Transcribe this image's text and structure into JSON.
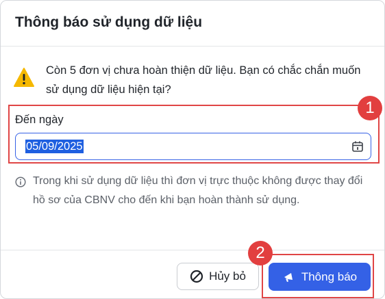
{
  "dialog": {
    "title": "Thông báo sử dụng dữ liệu",
    "message": "Còn 5 đơn vị chưa hoàn thiện dữ liệu. Bạn có chắc chắn muốn sử dụng dữ liệu hiện tại?",
    "field_label": "Đến ngày",
    "date_value": "05/09/2025",
    "note": "Trong khi sử dụng dữ liệu thì đơn vị trực thuộc không được thay đổi hồ sơ của CBNV cho đến khi bạn hoàn thành sử dụng.",
    "cancel_label": "Hủy bỏ",
    "notify_label": "Thông báo"
  },
  "annotations": {
    "badge_1": "1",
    "badge_2": "2"
  },
  "icons": {
    "warning": "warning-triangle-icon",
    "calendar": "calendar-icon",
    "info": "info-circle-icon",
    "cancel": "ban-icon",
    "notify": "megaphone-icon"
  },
  "colors": {
    "primary": "#3461e6",
    "annotation": "#e23f3f",
    "warning": "#f5b800"
  }
}
